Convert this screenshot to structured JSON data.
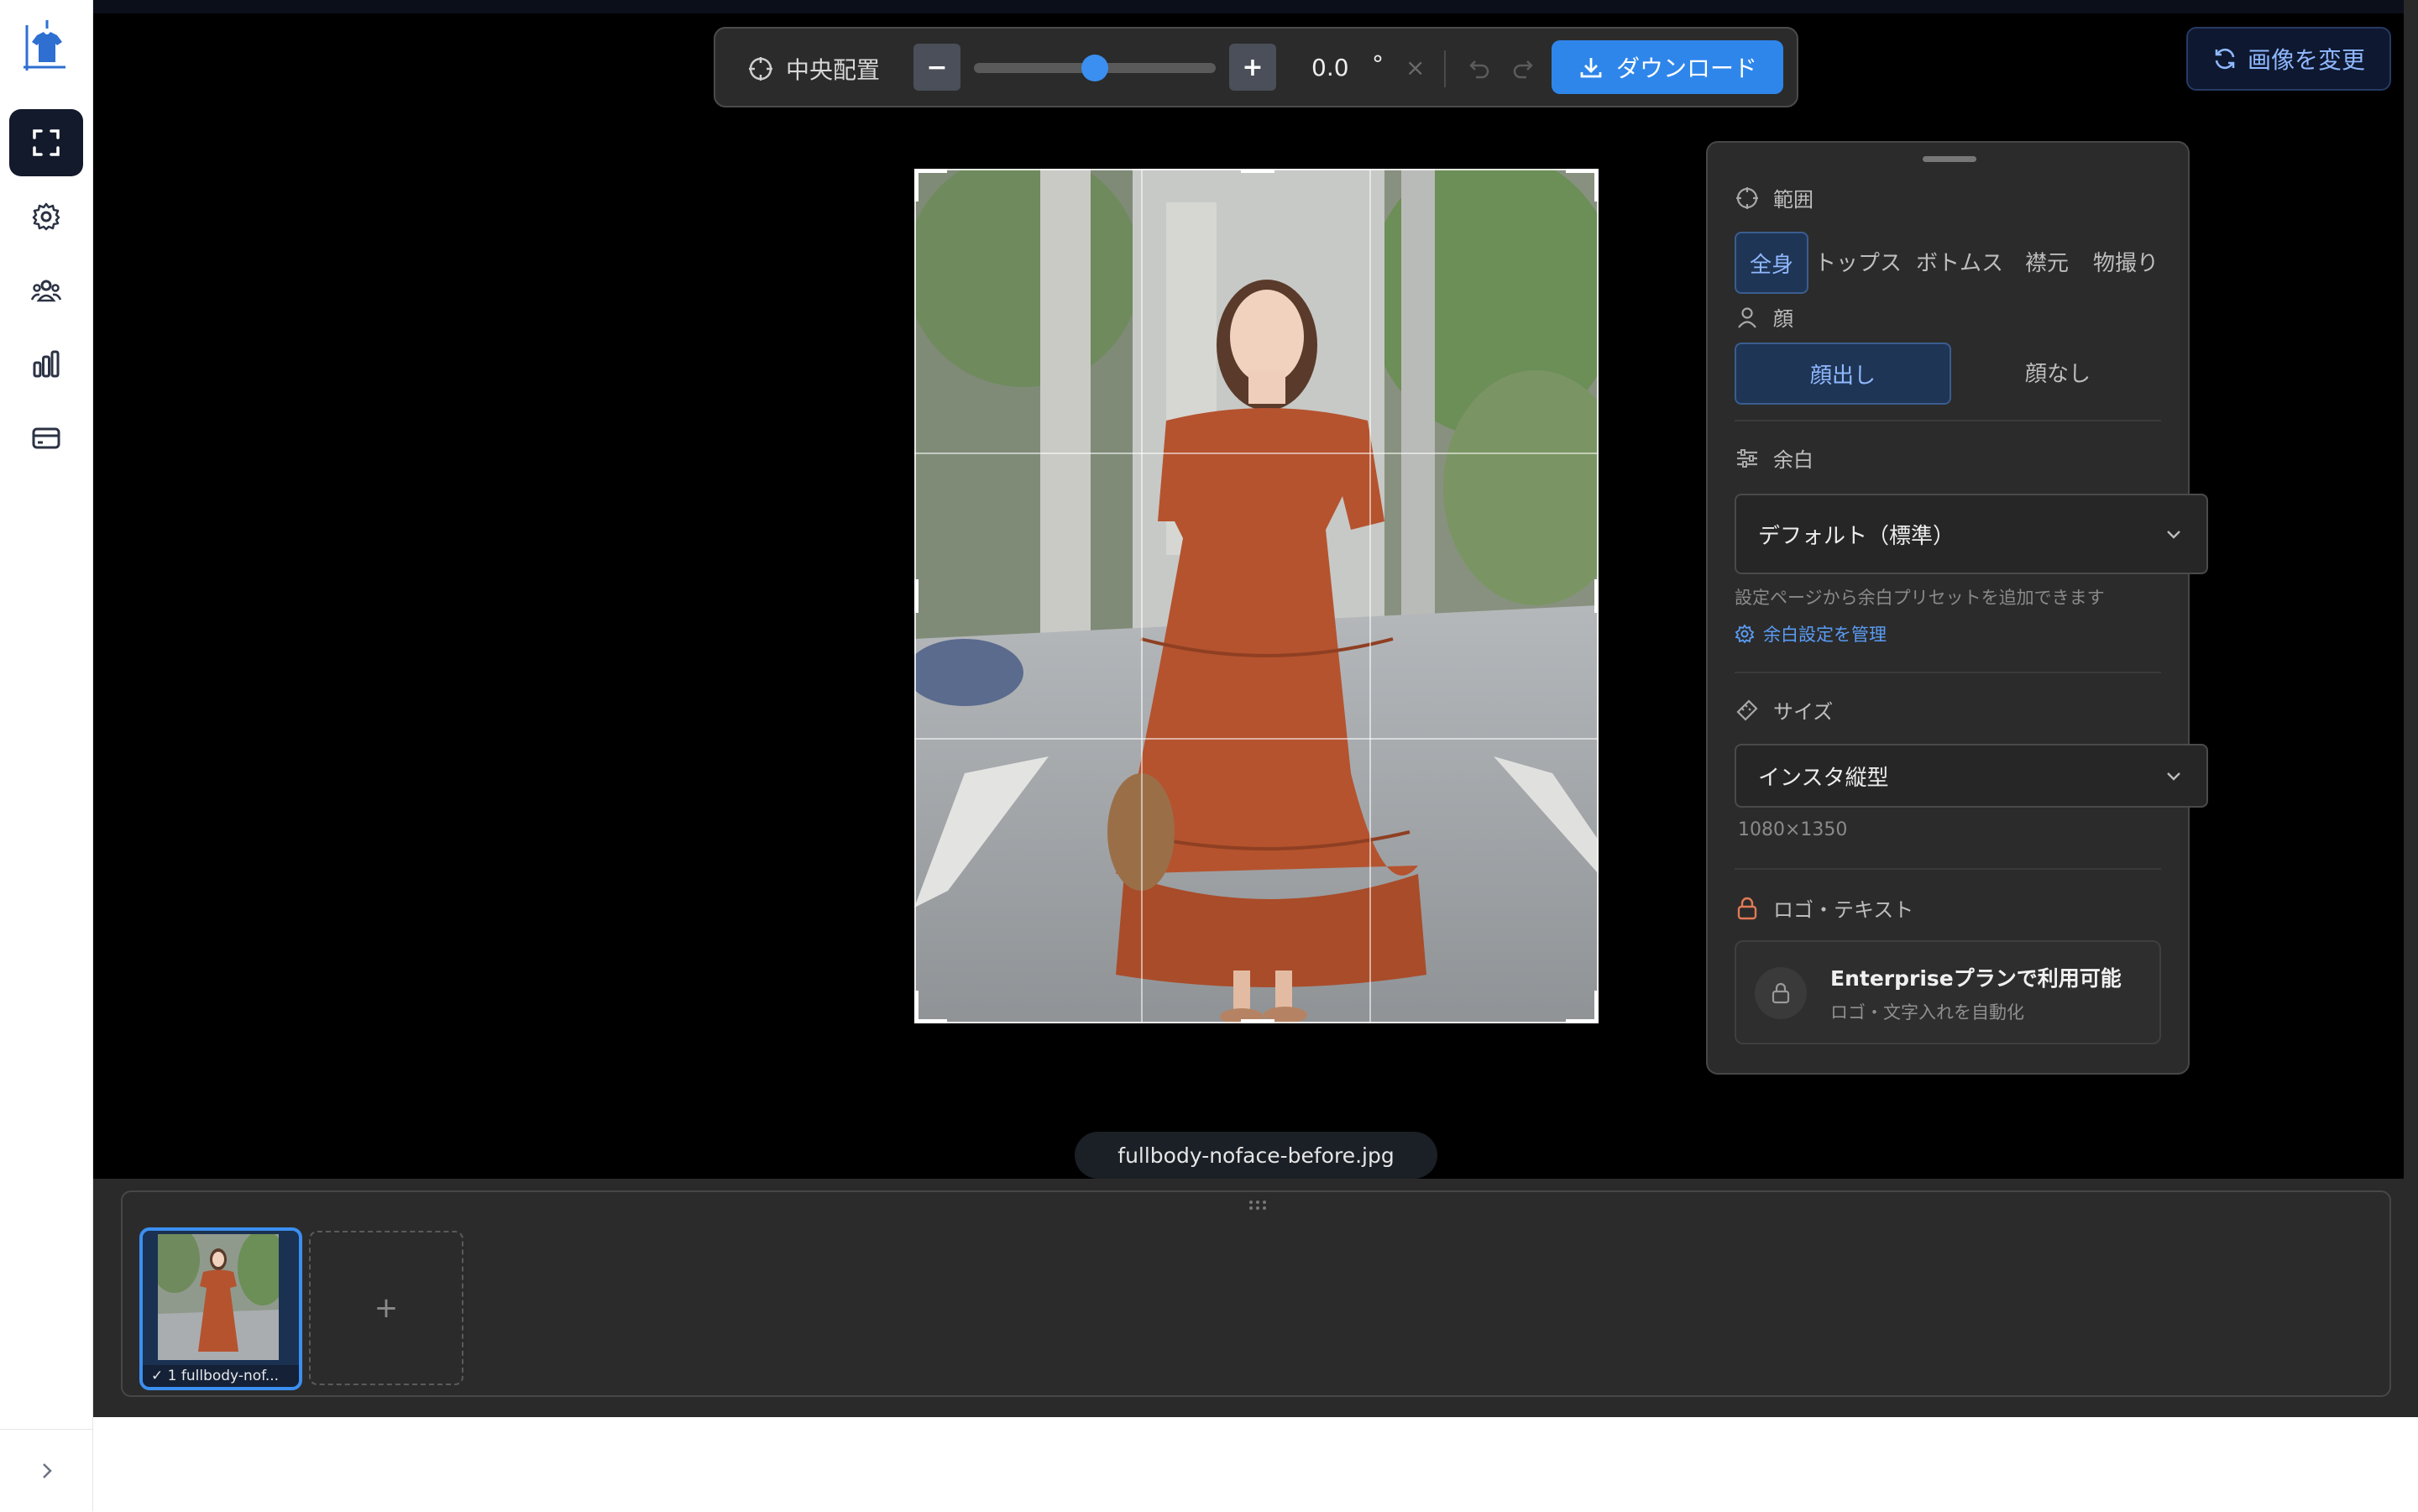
{
  "toolbar": {
    "center_label": "中央配置",
    "minus_label": "−",
    "plus_label": "+",
    "rotation_value": "0.0",
    "rotation_unit": "°",
    "reset_symbol": "×",
    "download_label": "ダウンロード",
    "zoom_fraction": 0.5
  },
  "change_image_label": "画像を変更",
  "panel": {
    "range_label": "範囲",
    "range_tabs": [
      "全身",
      "トップス",
      "ボトムス",
      "襟元",
      "物撮り"
    ],
    "range_selected": "全身",
    "face_label": "顔",
    "face_options": [
      "顔出し",
      "顔なし"
    ],
    "face_selected": "顔出し",
    "margin_label": "余白",
    "margin_value": "デフォルト（標準）",
    "margin_hint": "設定ページから余白プリセットを追加できます",
    "margin_manage_link": "余白設定を管理",
    "size_label": "サイズ",
    "size_value": "インスタ縦型",
    "size_dims": "1080×1350",
    "logo_label": "ロゴ・テキスト",
    "enterprise_title": "Enterpriseプランで利用可能",
    "enterprise_sub": "ロゴ・文字入れを自動化"
  },
  "filename": "fullbody-noface-before.jpg",
  "filmstrip": {
    "thumb_caption": "✓ 1 fullbody-nof...",
    "add_label": "+"
  },
  "colors": {
    "accent": "#2f86ea",
    "canvas": "#000000",
    "panel": "#2b2b2b",
    "dress": "#b5532f"
  }
}
